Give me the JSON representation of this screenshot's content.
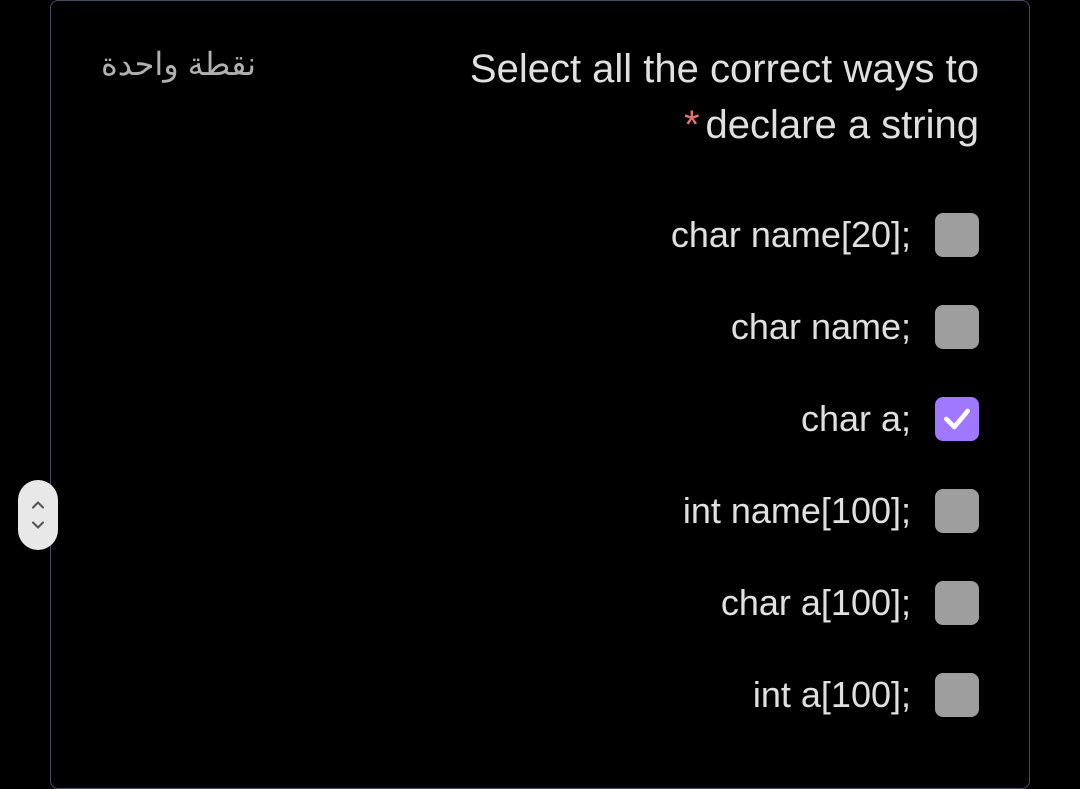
{
  "points_label": "نقطة واحدة",
  "question_line1": "Select all the correct ways to",
  "question_line2": "declare a string",
  "required_marker": "*",
  "options": [
    {
      "label": "char name[20];",
      "checked": false
    },
    {
      "label": "char name;",
      "checked": false
    },
    {
      "label": "char a;",
      "checked": true
    },
    {
      "label": "int name[100];",
      "checked": false
    },
    {
      "label": "char a[100];",
      "checked": false
    },
    {
      "label": "int a[100];",
      "checked": false
    }
  ],
  "colors": {
    "accent": "#a078ff",
    "required": "#e57373",
    "card_border": "#4a4a6a"
  }
}
